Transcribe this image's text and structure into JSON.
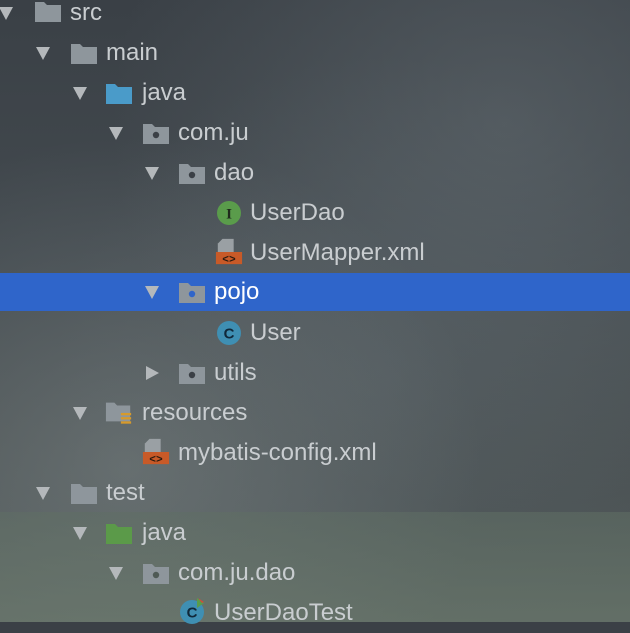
{
  "tree": {
    "nodes": [
      {
        "label": "src"
      },
      {
        "label": "main"
      },
      {
        "label": "java"
      },
      {
        "label": "com.ju"
      },
      {
        "label": "dao"
      },
      {
        "label": "UserDao"
      },
      {
        "label": "UserMapper.xml"
      },
      {
        "label": "pojo"
      },
      {
        "label": "User"
      },
      {
        "label": "utils"
      },
      {
        "label": "resources"
      },
      {
        "label": "mybatis-config.xml"
      },
      {
        "label": "test"
      },
      {
        "label": "java"
      },
      {
        "label": "com.ju.dao"
      },
      {
        "label": "UserDaoTest"
      }
    ],
    "selected": "pojo"
  },
  "icons": {
    "interface_letter": "I",
    "class_letter": "C",
    "xml_tag": "<>"
  },
  "colors": {
    "selection": "#2f65ca",
    "source_folder": "#4a9bc9",
    "test_folder": "#5b9a49",
    "package_folder": "#8e969c",
    "interface_icon": "#5a9c4b",
    "class_icon": "#3f8fb3",
    "xml_icon": "#c85a28"
  }
}
